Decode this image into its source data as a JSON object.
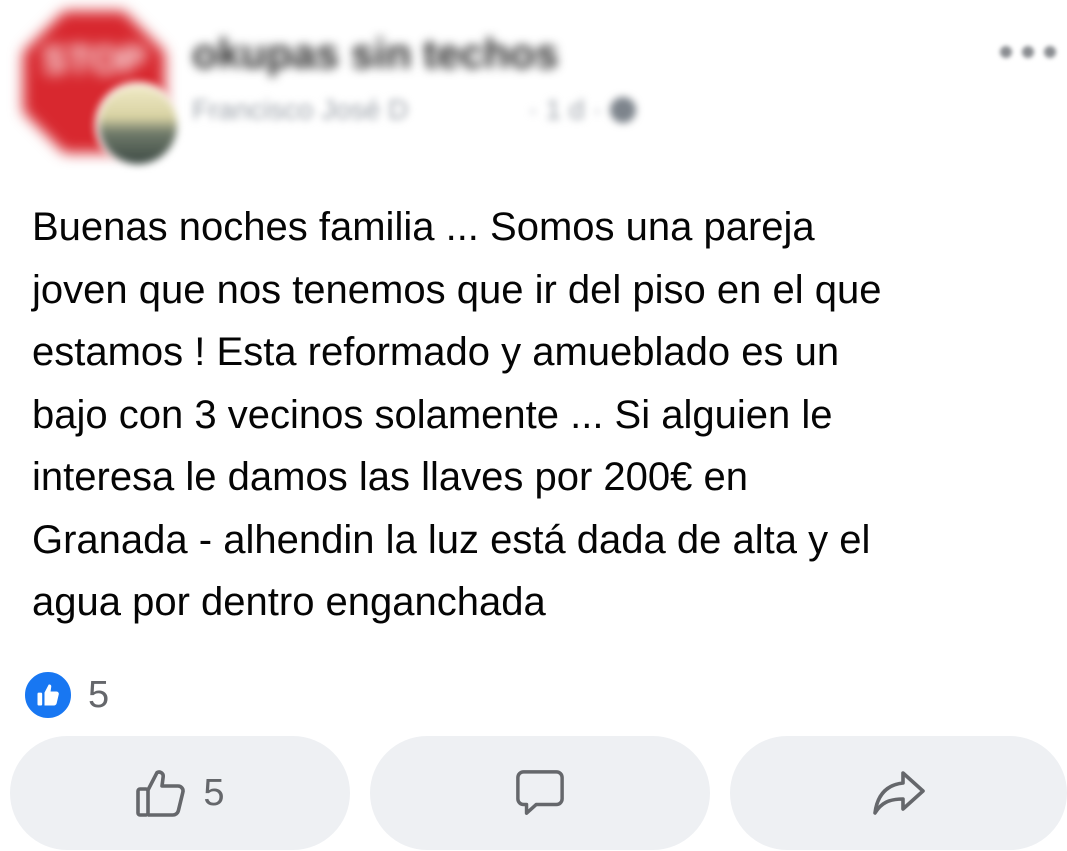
{
  "header": {
    "group_name": "okupas sin techos",
    "author_name": "Francisco José D",
    "post_time": "1 d",
    "meta_separator": "·",
    "group_avatar_icon": "stop-sign-icon",
    "more_icon": "more-options-icon"
  },
  "post": {
    "text": "Buenas noches familia ... Somos una pareja\njoven que nos tenemos que ir del piso en el que\nestamos ! Esta reformado y amueblado es un\nbajo con 3 vecinos solamente ... Si alguien le\ninteresa le damos las llaves por 200€ en\nGranada - alhendin  la luz está dada de alta y el\nagua por dentro enganchada"
  },
  "reactions": {
    "icon": "like-reaction-icon",
    "count": "5"
  },
  "actions": {
    "like_icon": "thumbs-up-icon",
    "like_count": "5",
    "comment_icon": "comment-icon",
    "share_icon": "share-icon"
  },
  "colors": {
    "facebook_blue": "#1877f2",
    "button_bg": "#eef0f3",
    "secondary_text": "#65676b",
    "stop_red": "#d8282f"
  }
}
